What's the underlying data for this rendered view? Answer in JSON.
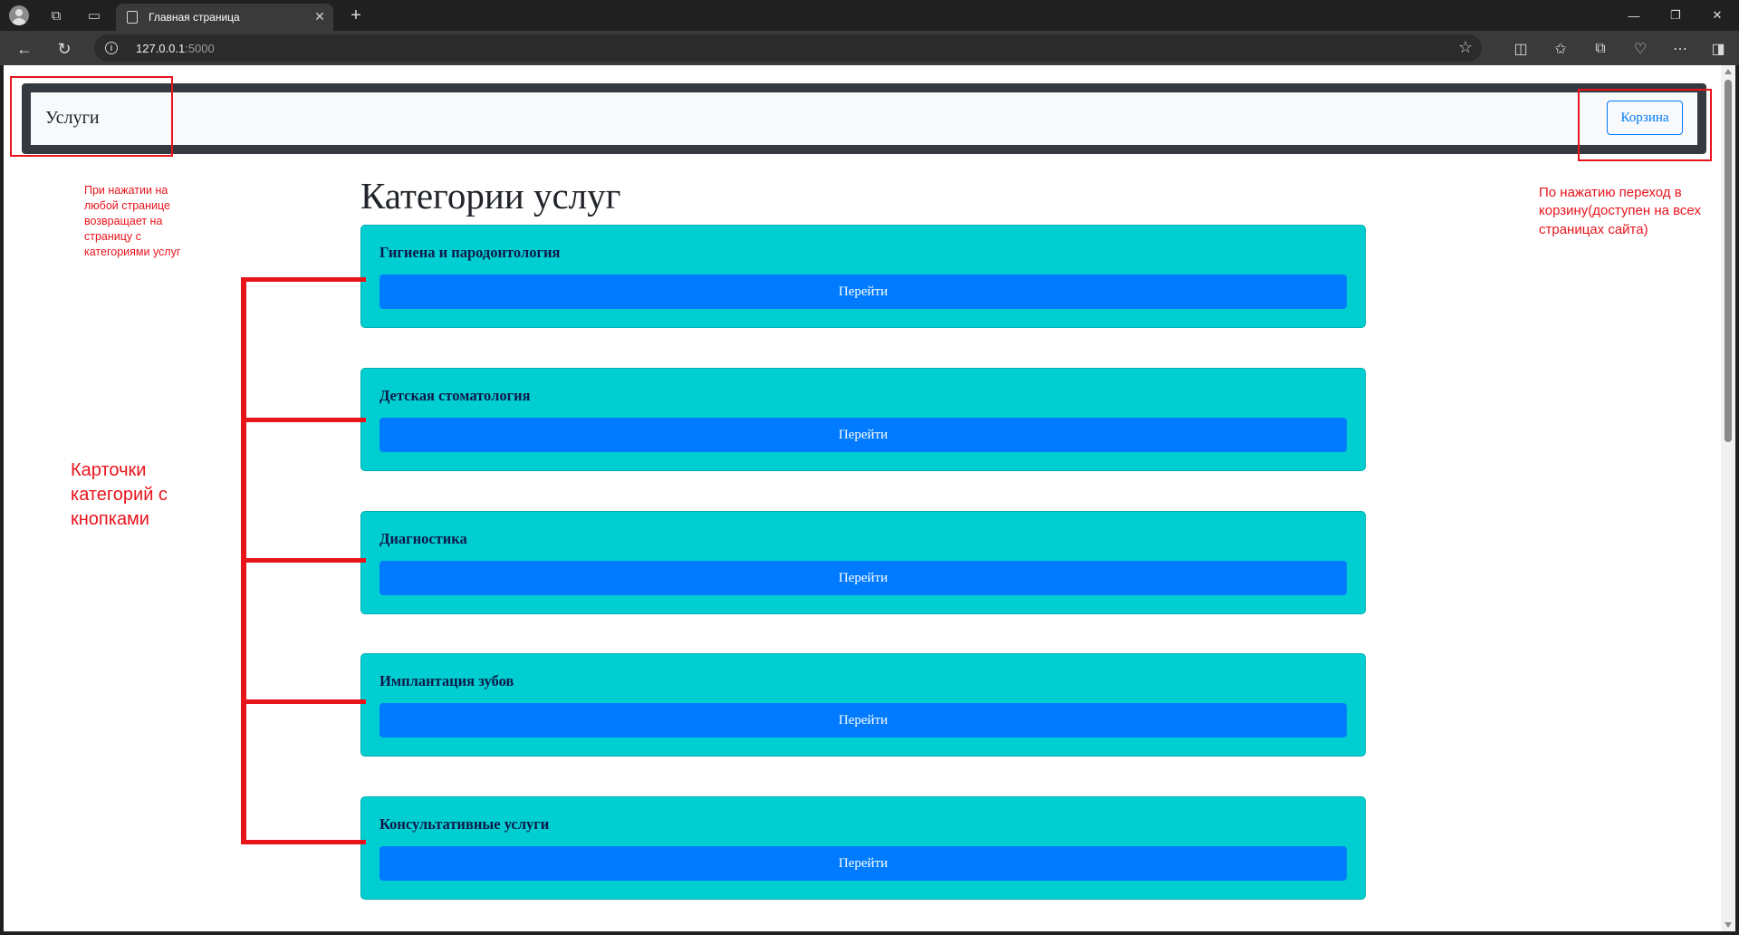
{
  "browser": {
    "tab_title": "Главная страница",
    "url_host": "127.0.0.1",
    "url_port": ":5000"
  },
  "navbar": {
    "brand": "Услуги",
    "cart_button": "Корзина"
  },
  "main": {
    "title": "Категории услуг",
    "categories": [
      {
        "title": "Гигиена и пародонтология",
        "button": "Перейти"
      },
      {
        "title": "Детская стоматология",
        "button": "Перейти"
      },
      {
        "title": "Диагностика",
        "button": "Перейти"
      },
      {
        "title": "Имплантация зубов",
        "button": "Перейти"
      },
      {
        "title": "Консультативные услуги",
        "button": "Перейти"
      }
    ]
  },
  "annotations": {
    "brand_note": "При нажатии на любой странице возвращает на страницу с категориями услуг",
    "cart_note": "По нажатию переход в корзину(доступен на всех страницах сайта)",
    "cards_note": "Карточки категорий с кнопками"
  },
  "colors": {
    "card_bg": "#00ced1",
    "primary": "#007bff",
    "navbar_border": "#343a40",
    "annotation": "#e8141c"
  }
}
